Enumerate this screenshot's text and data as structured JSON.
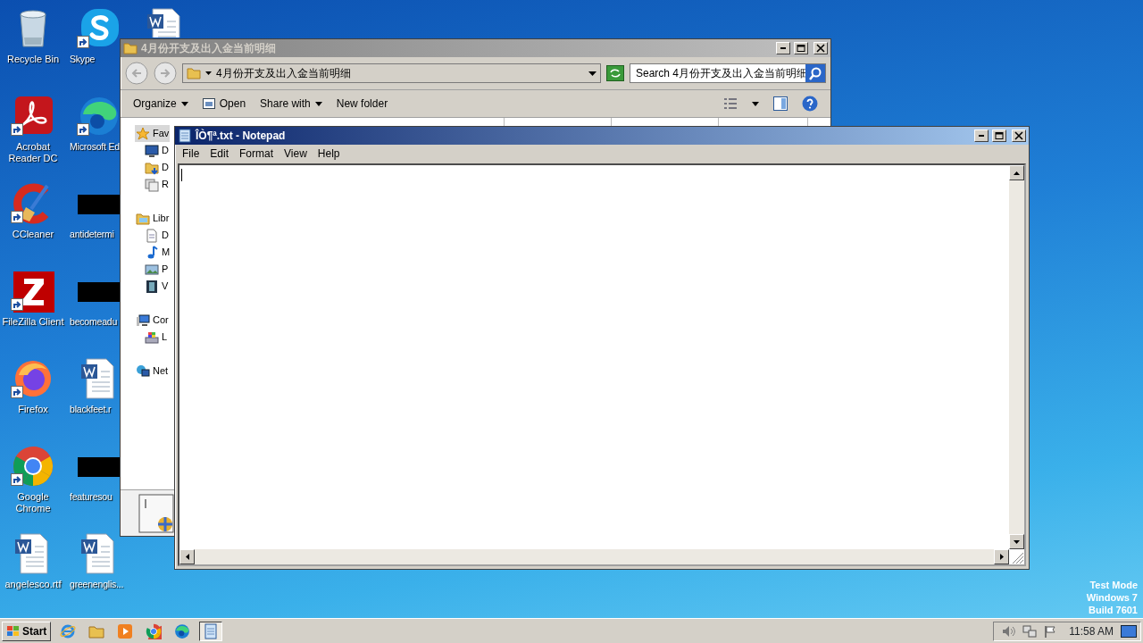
{
  "desktop_icons": [
    {
      "label": "Recycle Bin",
      "kind": "recycle",
      "shortcut": false
    },
    {
      "label": "Acrobat Reader DC",
      "kind": "acrobat",
      "shortcut": true
    },
    {
      "label": "CCleaner",
      "kind": "ccleaner",
      "shortcut": true
    },
    {
      "label": "FileZilla Client",
      "kind": "filezilla",
      "shortcut": true
    },
    {
      "label": "Firefox",
      "kind": "firefox",
      "shortcut": true
    },
    {
      "label": "Google Chrome",
      "kind": "chrome",
      "shortcut": true
    },
    {
      "label": "angelesco.rtf",
      "kind": "word",
      "shortcut": false
    },
    {
      "label": "Skype",
      "kind": "skype",
      "shortcut": true
    },
    {
      "label": "Microsoft Ed",
      "kind": "edge",
      "shortcut": true
    },
    {
      "label": "antidetermi",
      "kind": "hidden",
      "shortcut": false
    },
    {
      "label": "becomeadu",
      "kind": "hidden",
      "shortcut": false
    },
    {
      "label": "blackfeet.r",
      "kind": "word",
      "shortcut": false
    },
    {
      "label": "featuresou",
      "kind": "hidden",
      "shortcut": false
    },
    {
      "label": "greenenglis...",
      "kind": "word",
      "shortcut": false
    },
    {
      "kind": "word",
      "shortcut": false
    }
  ],
  "explorer": {
    "title": "4月份开支及出入金当前明细",
    "address": "4月份开支及出入金当前明细",
    "search": {
      "placeholder": "Search 4月份开支及出入金当前明细"
    },
    "toolbar": [
      {
        "label": "Organize",
        "kind": "menu"
      },
      {
        "label": "Open",
        "kind": "open"
      },
      {
        "label": "Share with",
        "kind": "menu"
      },
      {
        "label": "New folder",
        "kind": "plain"
      }
    ],
    "sidebar": [
      {
        "label": "Fav",
        "kind": "star",
        "selected": true,
        "children": [
          {
            "label": "D",
            "kind": "desktop",
            "selected": false
          },
          {
            "label": "D",
            "kind": "download",
            "selected": false
          },
          {
            "label": "R",
            "kind": "recent",
            "selected": false
          }
        ]
      },
      {
        "label": "Libr",
        "kind": "library",
        "selected": false,
        "children": [
          {
            "label": "D",
            "kind": "document",
            "selected": false
          },
          {
            "label": "M",
            "kind": "music",
            "selected": false
          },
          {
            "label": "P",
            "kind": "pictures",
            "selected": false
          },
          {
            "label": "V",
            "kind": "videos",
            "selected": false
          }
        ]
      },
      {
        "label": "Cor",
        "kind": "computer",
        "selected": false,
        "children": [
          {
            "label": "L",
            "kind": "disk",
            "selected": false
          }
        ]
      },
      {
        "label": "Net",
        "kind": "network",
        "selected": false
      }
    ]
  },
  "notepad": {
    "title": "ÎÒ¶ª.txt - Notepad",
    "menu": [
      "File",
      "Edit",
      "Format",
      "View",
      "Help"
    ]
  },
  "taskbar": {
    "start": "Start",
    "items": [
      {
        "kind": "ie",
        "selected": false
      },
      {
        "kind": "folder",
        "selected": false
      },
      {
        "kind": "media",
        "selected": false
      },
      {
        "kind": "chrome",
        "selected": false
      },
      {
        "kind": "edge",
        "selected": false
      },
      {
        "kind": "notepad",
        "selected": true
      }
    ],
    "clock": "11:58 AM"
  },
  "watermark_text": [
    "Test Mode",
    "Windows 7",
    "Build 7601"
  ]
}
